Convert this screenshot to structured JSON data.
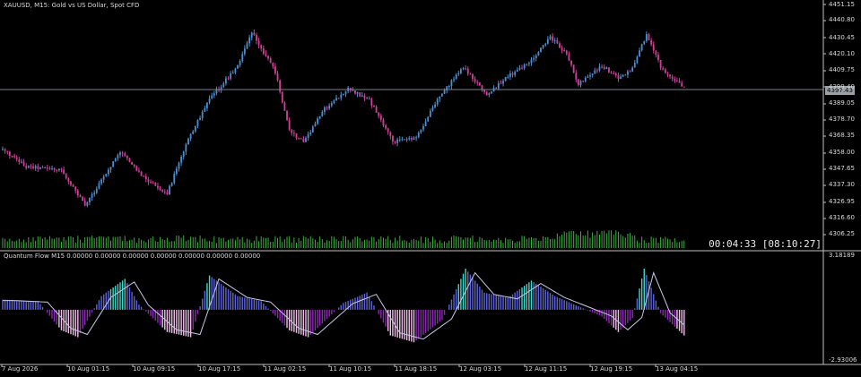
{
  "chart_header": {
    "symbol_title": "XAUUSD, M15:  Gold vs US Dollar, Spot CFD",
    "timer": "00:04:33 [08:10:27]",
    "current_price_tag": "4397.43"
  },
  "indicator": {
    "title": "Quantum Flow M15 0.00000 0.00000 0.00000 0.00000 0.00000 0.00000 0.00000",
    "scale_top": "3.18189",
    "scale_bottom": "-2.93006"
  },
  "price_scale": [
    "4451.15",
    "4440.80",
    "4430.45",
    "4420.10",
    "4409.75",
    "4399.40",
    "4389.05",
    "4378.70",
    "4368.35",
    "4358.00",
    "4347.65",
    "4337.30",
    "4326.95",
    "4316.60",
    "4306.25"
  ],
  "time_axis": [
    "7 Aug 2026",
    "10 Aug 01:15",
    "10 Aug 09:15",
    "10 Aug 17:15",
    "11 Aug 02:15",
    "11 Aug 10:15",
    "11 Aug 18:15",
    "12 Aug 03:15",
    "12 Aug 11:15",
    "12 Aug 19:15",
    "13 Aug 04:15"
  ],
  "colors": {
    "background": "#000000",
    "bull_candle": "#4a8fd0",
    "bear_candle": "#d0409a",
    "volume": "#3fb040",
    "grid_line": "#808890",
    "hist_positive": "#5d63d6",
    "hist_negative": "#8a2ab0",
    "hist_peak": "#40d8c8",
    "hist_trough": "#f0c0e8"
  },
  "chart_data": {
    "type": "line",
    "title": "XAUUSD, M15:  Gold vs US Dollar, Spot CFD",
    "price_series_keypoints": [
      {
        "bar": 0,
        "price": 4358
      },
      {
        "bar": 10,
        "price": 4347
      },
      {
        "bar": 25,
        "price": 4345
      },
      {
        "bar": 35,
        "price": 4322
      },
      {
        "bar": 50,
        "price": 4357
      },
      {
        "bar": 60,
        "price": 4340
      },
      {
        "bar": 70,
        "price": 4330
      },
      {
        "bar": 80,
        "price": 4368
      },
      {
        "bar": 88,
        "price": 4390
      },
      {
        "bar": 100,
        "price": 4412
      },
      {
        "bar": 106,
        "price": 4433
      },
      {
        "bar": 116,
        "price": 4408
      },
      {
        "bar": 122,
        "price": 4370
      },
      {
        "bar": 128,
        "price": 4363
      },
      {
        "bar": 137,
        "price": 4384
      },
      {
        "bar": 147,
        "price": 4397
      },
      {
        "bar": 156,
        "price": 4390
      },
      {
        "bar": 166,
        "price": 4363
      },
      {
        "bar": 176,
        "price": 4366
      },
      {
        "bar": 185,
        "price": 4390
      },
      {
        "bar": 196,
        "price": 4411
      },
      {
        "bar": 206,
        "price": 4393
      },
      {
        "bar": 215,
        "price": 4405
      },
      {
        "bar": 225,
        "price": 4415
      },
      {
        "bar": 233,
        "price": 4430
      },
      {
        "bar": 240,
        "price": 4420
      },
      {
        "bar": 245,
        "price": 4400
      },
      {
        "bar": 255,
        "price": 4412
      },
      {
        "bar": 262,
        "price": 4404
      },
      {
        "bar": 268,
        "price": 4410
      },
      {
        "bar": 274,
        "price": 4432
      },
      {
        "bar": 280,
        "price": 4411
      },
      {
        "bar": 290,
        "price": 4397
      }
    ],
    "oscillator_keypoints": [
      {
        "bar": 0,
        "value": 0.6
      },
      {
        "bar": 15,
        "value": 0.5
      },
      {
        "bar": 25,
        "value": -1.2
      },
      {
        "bar": 32,
        "value": -1.6
      },
      {
        "bar": 42,
        "value": 0.8
      },
      {
        "bar": 52,
        "value": 1.8
      },
      {
        "bar": 58,
        "value": 0.3
      },
      {
        "bar": 70,
        "value": -1.3
      },
      {
        "bar": 80,
        "value": -1.6
      },
      {
        "bar": 88,
        "value": 2.0
      },
      {
        "bar": 100,
        "value": 0.8
      },
      {
        "bar": 110,
        "value": 0.5
      },
      {
        "bar": 122,
        "value": -1.2
      },
      {
        "bar": 130,
        "value": -1.6
      },
      {
        "bar": 145,
        "value": 0.4
      },
      {
        "bar": 155,
        "value": 1.0
      },
      {
        "bar": 165,
        "value": -1.5
      },
      {
        "bar": 175,
        "value": -1.9
      },
      {
        "bar": 187,
        "value": -0.6
      },
      {
        "bar": 197,
        "value": 2.4
      },
      {
        "bar": 205,
        "value": 1.0
      },
      {
        "bar": 215,
        "value": 0.7
      },
      {
        "bar": 225,
        "value": 1.7
      },
      {
        "bar": 235,
        "value": 0.8
      },
      {
        "bar": 245,
        "value": 0.2
      },
      {
        "bar": 255,
        "value": -0.4
      },
      {
        "bar": 262,
        "value": -1.3
      },
      {
        "bar": 268,
        "value": -0.5
      },
      {
        "bar": 273,
        "value": 2.4
      },
      {
        "bar": 280,
        "value": -0.2
      },
      {
        "bar": 290,
        "value": -1.5
      }
    ],
    "price_range": [
      4300,
      4451.15
    ],
    "oscillator_range": [
      -2.93006,
      3.18189
    ],
    "volume_level": 0.7
  }
}
